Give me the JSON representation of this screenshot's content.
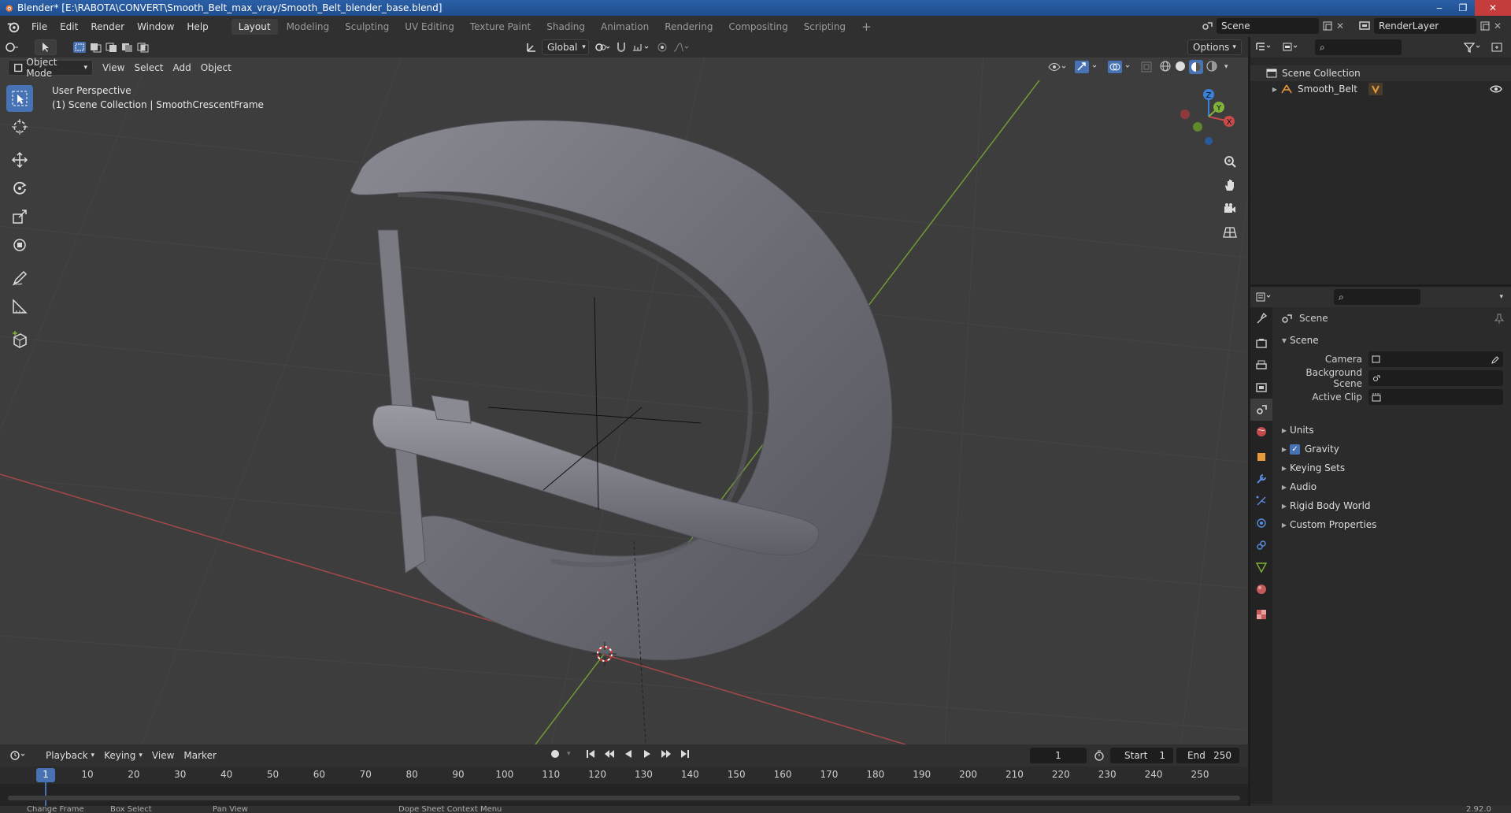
{
  "title_bar": {
    "title": "Blender* [E:\\RABOTA\\CONVERT\\Smooth_Belt_max_vray/Smooth_Belt_blender_base.blend]",
    "minimize": "‒",
    "maximize": "❐",
    "close": "✕"
  },
  "menu": {
    "items": [
      "File",
      "Edit",
      "Render",
      "Window",
      "Help"
    ]
  },
  "workspaces": {
    "tabs": [
      "Layout",
      "Modeling",
      "Sculpting",
      "UV Editing",
      "Texture Paint",
      "Shading",
      "Animation",
      "Rendering",
      "Compositing",
      "Scripting"
    ],
    "active": "Layout",
    "add": "+"
  },
  "scene_selector": {
    "value": "Scene"
  },
  "view_layer_selector": {
    "value": "RenderLayer"
  },
  "viewport_header": {
    "orientation": "Global",
    "options": "Options",
    "mode": "Object Mode",
    "menus": [
      "View",
      "Select",
      "Add",
      "Object"
    ]
  },
  "viewport_overlay": {
    "perspective": "User Perspective",
    "collection_info": "(1) Scene Collection | SmoothCrescentFrame"
  },
  "gizmo": {
    "x": "X",
    "y": "Y",
    "z": "Z"
  },
  "outliner": {
    "root": "Scene Collection",
    "items": [
      {
        "label": "Smooth_Belt"
      }
    ]
  },
  "properties": {
    "context_title": "Scene",
    "panel_title": "Scene",
    "fields": [
      {
        "label": "Camera",
        "value": ""
      },
      {
        "label": "Background Scene",
        "value": ""
      },
      {
        "label": "Active Clip",
        "value": ""
      }
    ],
    "subpanels": [
      {
        "label": "Units",
        "checkbox": false
      },
      {
        "label": "Gravity",
        "checkbox": true
      },
      {
        "label": "Keying Sets",
        "checkbox": false
      },
      {
        "label": "Audio",
        "checkbox": false
      },
      {
        "label": "Rigid Body World",
        "checkbox": false
      },
      {
        "label": "Custom Properties",
        "checkbox": false
      }
    ]
  },
  "timeline": {
    "menus": [
      "Playback",
      "Keying",
      "View",
      "Marker"
    ],
    "current_frame": "1",
    "start_label": "Start",
    "start_value": "1",
    "end_label": "End",
    "end_value": "250",
    "ruler_ticks": [
      "1",
      "10",
      "20",
      "30",
      "40",
      "50",
      "60",
      "70",
      "80",
      "90",
      "100",
      "110",
      "120",
      "130",
      "140",
      "150",
      "160",
      "170",
      "180",
      "190",
      "200",
      "210",
      "220",
      "230",
      "240",
      "250"
    ]
  },
  "statusbar": {
    "items": [
      "Change Frame",
      "Box Select",
      "Pan View",
      "Dope Sheet Context Menu"
    ],
    "version": "2.92.0"
  },
  "colors": {
    "accent": "#4772b3",
    "x_axis": "#c84a4a",
    "y_axis": "#7fb33a",
    "z_axis": "#3a7fd8",
    "viewport_bg": "#3d3d3d"
  }
}
